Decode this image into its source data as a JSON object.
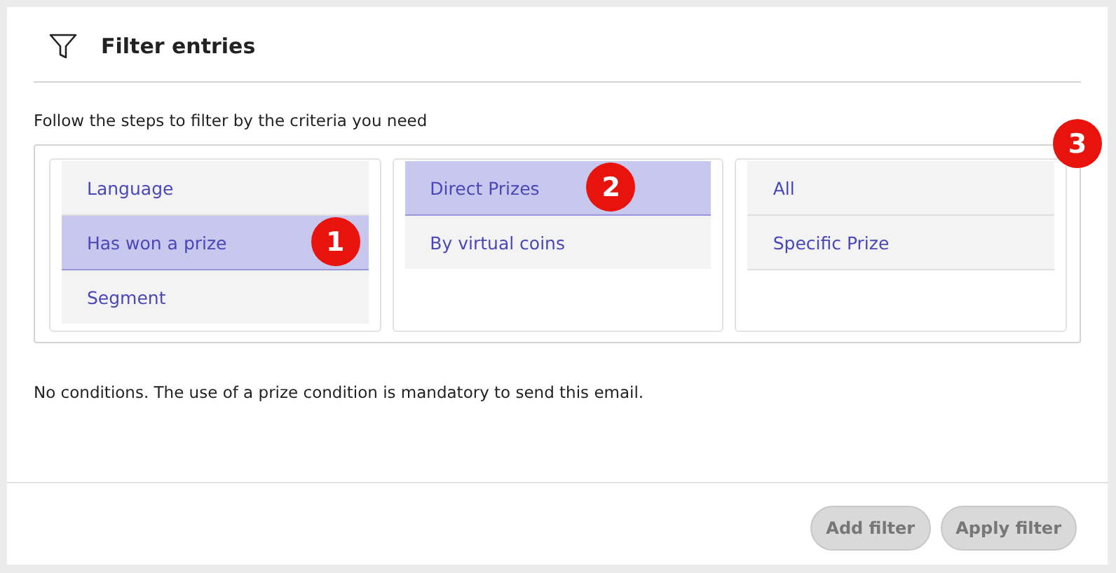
{
  "header": {
    "title": "Filter entries"
  },
  "intro": "Follow the steps to filter by the criteria you need",
  "columns": [
    {
      "badge": "1",
      "items": [
        {
          "label": "Language",
          "selected": false
        },
        {
          "label": "Has won a prize",
          "selected": true
        },
        {
          "label": "Segment",
          "selected": false
        }
      ]
    },
    {
      "badge": "2",
      "items": [
        {
          "label": "Direct Prizes",
          "selected": true
        },
        {
          "label": "By virtual coins",
          "selected": false
        }
      ]
    },
    {
      "badge": "3",
      "items": [
        {
          "label": "All",
          "selected": false
        },
        {
          "label": "Specific Prize",
          "selected": false
        }
      ]
    }
  ],
  "note": "No conditions. The use of a prize condition is mandatory to send this email.",
  "buttons": [
    {
      "label": "Add filter",
      "disabled": true
    },
    {
      "label": "Apply filter",
      "disabled": true
    }
  ]
}
